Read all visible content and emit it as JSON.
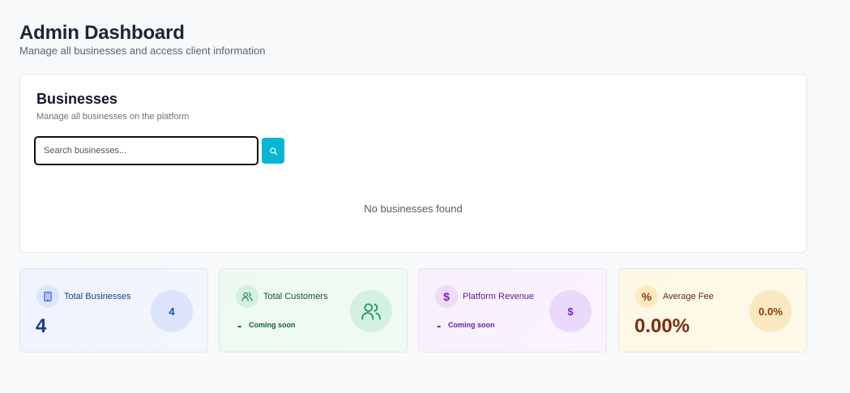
{
  "header": {
    "title": "Admin Dashboard",
    "subtitle": "Manage all businesses and access client information"
  },
  "businesses": {
    "title": "Businesses",
    "subtitle": "Manage all businesses on the platform",
    "search": {
      "placeholder": "Search businesses...",
      "value": ""
    },
    "search_button_icon": "search-icon",
    "empty_text": "No businesses found"
  },
  "stats": [
    {
      "label": "Total Businesses",
      "icon": "building-icon",
      "value": "4",
      "circle_value": "4",
      "color": "#1e3a8a"
    },
    {
      "label": "Total Customers",
      "icon": "users-icon",
      "value": "-",
      "note": "Coming soon",
      "circle_icon": "users-icon",
      "color": "#15632f"
    },
    {
      "label": "Platform Revenue",
      "icon": "dollar-icon",
      "icon_glyph": "$",
      "value": "-",
      "note": "Coming soon",
      "circle_value": "$",
      "color": "#6b21a8"
    },
    {
      "label": "Average Fee",
      "icon": "percent-icon",
      "icon_glyph": "%",
      "value": "0.00%",
      "circle_value": "0.0%",
      "color": "#7c2d12"
    }
  ],
  "colors": {
    "accent": "#06b6d4",
    "background": "#f8f9fb"
  }
}
